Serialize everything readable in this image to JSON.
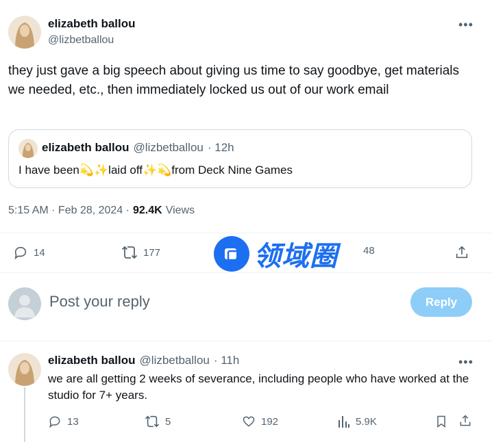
{
  "tweet": {
    "author_name": "elizabeth ballou",
    "author_handle": "@lizbetballou",
    "text": "they just gave a big speech about giving us time to say goodbye, get materials we needed, etc., then immediately locked us out of our work email",
    "timestamp": "5:15 AM · Feb 28, 2024 ·",
    "views_count": "92.4K",
    "views_label": "Views"
  },
  "quote": {
    "author_name": "elizabeth ballou",
    "author_handle": "@lizbetballou",
    "age": "· 12h",
    "text": "I have been💫✨laid off✨💫from Deck Nine Games"
  },
  "actions": {
    "replies": "14",
    "reposts": "177",
    "likes": "",
    "bookmarks": "48"
  },
  "reply_box": {
    "placeholder": "Post your reply",
    "button_label": "Reply"
  },
  "reply": {
    "author_name": "elizabeth ballou",
    "author_handle": "@lizbetballou",
    "age": "· 11h",
    "text": "we are all getting 2 weeks of severance, including people who have worked at the studio for 7+ years.",
    "replies": "13",
    "reposts": "5",
    "likes": "192",
    "views": "5.9K"
  },
  "watermark": {
    "text": "领域圈"
  },
  "icons": {
    "more": "more-horizontal-icon",
    "reply": "comment-icon",
    "repost": "repost-icon",
    "like": "heart-icon",
    "views": "analytics-icon",
    "bookmark": "bookmark-icon",
    "share": "share-icon"
  },
  "colors": {
    "text": "#0f1419",
    "muted": "#536471",
    "border": "#cfd9de",
    "reply_button": "#8ecdf8",
    "watermark": "#1d6ff2"
  }
}
